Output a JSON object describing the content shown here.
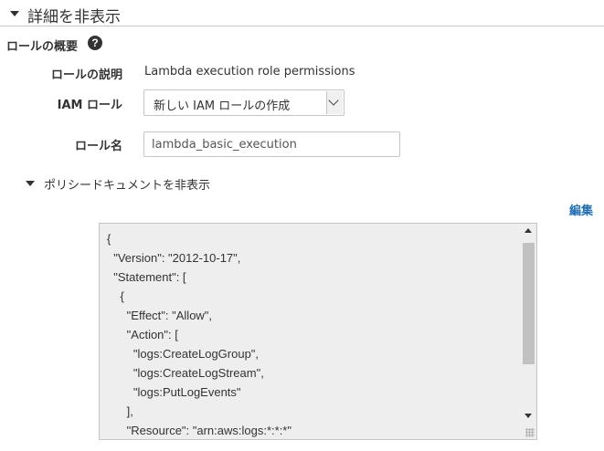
{
  "details_toggle": {
    "label": "詳細を非表示"
  },
  "role_summary": {
    "title": "ロールの概要",
    "help_icon": "question-circle-icon",
    "description_label": "ロールの説明",
    "description_value": "Lambda execution role permissions",
    "iam_role_label": "IAM ロール",
    "iam_role_selected": "新しい IAM ロールの作成",
    "role_name_label": "ロール名",
    "role_name_value": "lambda_basic_execution"
  },
  "policy": {
    "toggle_label": "ポリシードキュメントを非表示",
    "edit_label": "編集",
    "document": "{\n  \"Version\": \"2012-10-17\",\n  \"Statement\": [\n    {\n      \"Effect\": \"Allow\",\n      \"Action\": [\n        \"logs:CreateLogGroup\",\n        \"logs:CreateLogStream\",\n        \"logs:PutLogEvents\"\n      ],\n      \"Resource\": \"arn:aws:logs:*:*:*\""
  },
  "colors": {
    "link": "#1f6fb2",
    "text": "#333333",
    "code_bg": "#eeeeee"
  }
}
